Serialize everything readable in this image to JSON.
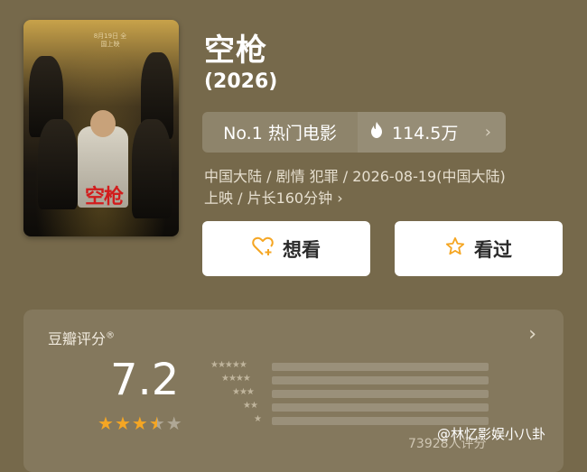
{
  "movie": {
    "title": "空枪",
    "year": "(2026)",
    "poster": {
      "title": "空枪",
      "date": "8月19日 全国上映"
    }
  },
  "rank": {
    "label": "No.1 热门电影",
    "heat": "114.5万",
    "heat_icon": "flame-icon"
  },
  "meta": {
    "line1": "中国大陆 / 剧情 犯罪 / 2026-08-19(中国大陆)",
    "line2": "上映 / 片长160分钟"
  },
  "buttons": {
    "want": "想看",
    "seen": "看过"
  },
  "rating": {
    "title": "豆瓣评分",
    "reg": "®",
    "score": "7.2",
    "stars_filled": 3.5,
    "stars_total": 5,
    "count": "73928人评分",
    "distribution_labels": [
      "★★★★★",
      "★★★★",
      "★★★",
      "★★",
      "★"
    ]
  },
  "watermark": "@林忆影娱小八卦",
  "colors": {
    "background": "#76694b",
    "star": "#f5a623",
    "heart": "#f5a623"
  }
}
